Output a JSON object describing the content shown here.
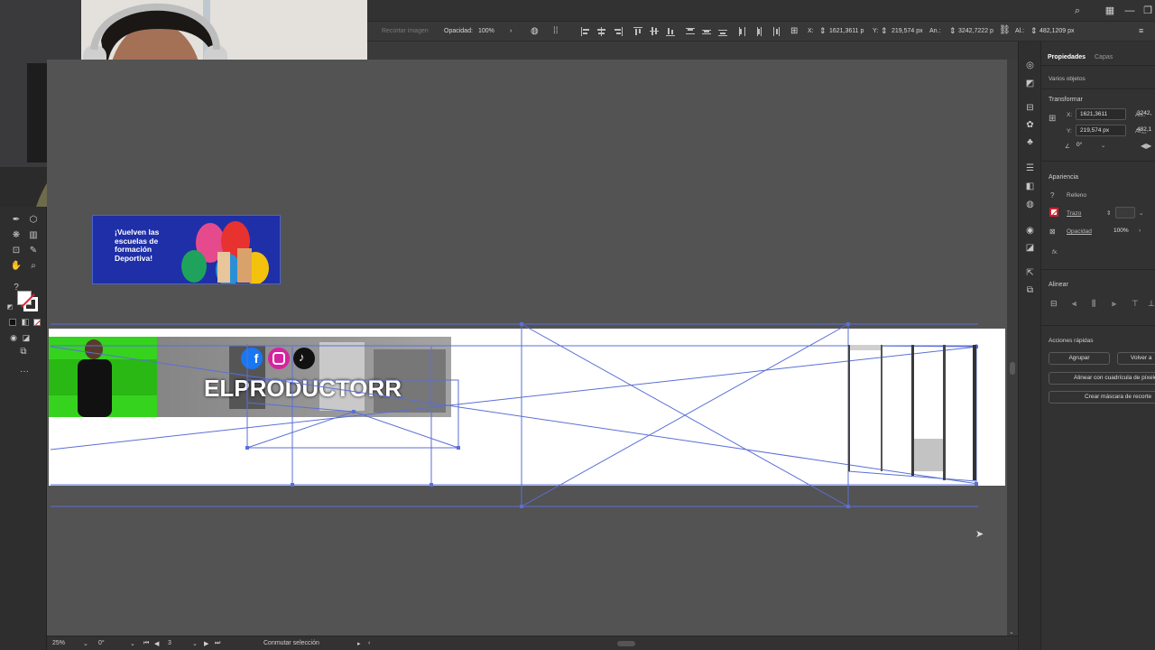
{
  "control_bar": {
    "crop_label": "Recortar imagen",
    "opacity_label": "Opacidad:",
    "opacity_value": "100%",
    "x_label": "X:",
    "x_value": "1621,3611 p",
    "y_label": "Y:",
    "y_value": "219,574 px",
    "w_label": "An.:",
    "w_value": "3242,7222 p",
    "h_label": "Al.:",
    "h_value": "482,1209 px"
  },
  "canvas": {
    "thumbnail_text": "¡Vuelven las escuelas de formación Deportiva!",
    "banner_title": "ELPRODUCTORR",
    "selection_color": "#5b6fd6"
  },
  "status_bar": {
    "zoom": "25%",
    "rotation": "0°",
    "artboard_number": "3",
    "mode": "Conmutar selección"
  },
  "properties_panel": {
    "tab_properties": "Propiedades",
    "tab_layers": "Capas",
    "selection_type": "Varios objetos",
    "transform": {
      "title": "Transformar",
      "x_label": "X:",
      "x_value": "1621,3611",
      "y_label": "Y:",
      "y_value": "219,574 px",
      "w_label": "An.:",
      "w_value": "3242,",
      "h_label": "Al.:",
      "h_value": "482,1",
      "angle_value": "0°"
    },
    "appearance": {
      "title": "Apariencia",
      "fill_label": "Relleno",
      "stroke_label": "Trazo",
      "opacity_label": "Opacidad",
      "opacity_value": "100%",
      "fx_label": "fx."
    },
    "align": {
      "title": "Alinear"
    },
    "quick_actions": {
      "title": "Acciones rápidas",
      "group_button": "Agrupar",
      "return_button": "Volver a",
      "align_pixel_grid_button": "Alinear con cuadrícula de píxeles",
      "clipping_mask_button": "Crear máscara de recorte"
    }
  }
}
